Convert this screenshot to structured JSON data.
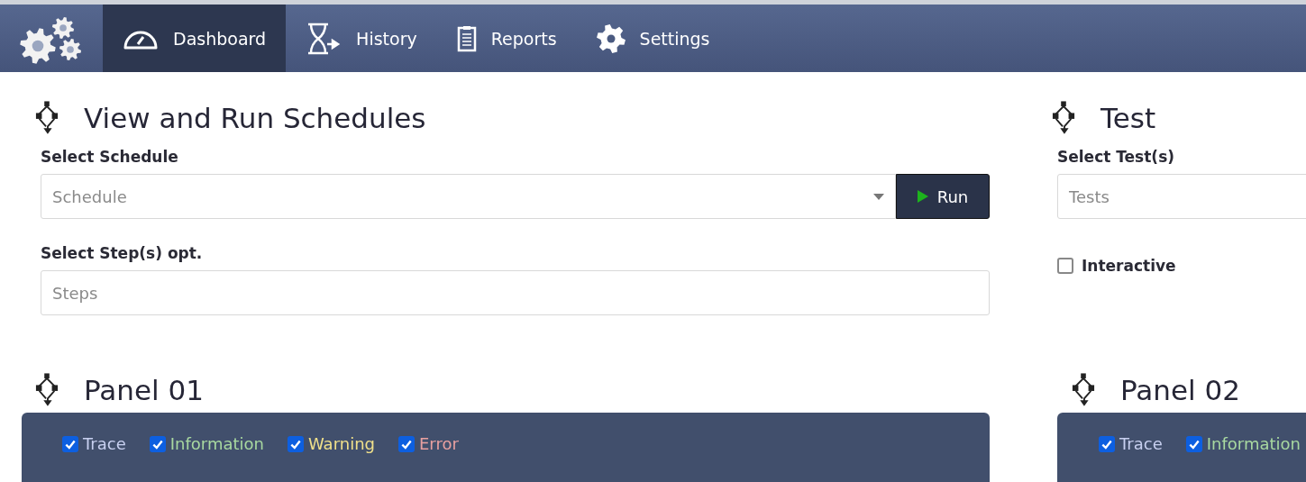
{
  "nav": {
    "items": [
      {
        "label": "Dashboard",
        "selected": true
      },
      {
        "label": "History",
        "selected": false
      },
      {
        "label": "Reports",
        "selected": false
      },
      {
        "label": "Settings",
        "selected": false
      }
    ]
  },
  "schedules": {
    "title": "View and Run Schedules",
    "schedule_label": "Select Schedule",
    "schedule_placeholder": "Schedule",
    "run_button": "Run",
    "steps_label": "Select Step(s) opt.",
    "steps_placeholder": "Steps"
  },
  "test": {
    "title": "Test",
    "tests_label": "Select Test(s)",
    "tests_placeholder": "Tests",
    "interactive": {
      "label": "Interactive",
      "checked": false
    }
  },
  "panels": [
    {
      "title": "Panel 01",
      "filters": [
        {
          "label": "Trace",
          "checked": true,
          "color": "#c8d0f0"
        },
        {
          "label": "Information",
          "checked": true,
          "color": "#a8d8a0"
        },
        {
          "label": "Warning",
          "checked": true,
          "color": "#f0e08a"
        },
        {
          "label": "Error",
          "checked": true,
          "color": "#e8a0a0"
        }
      ]
    },
    {
      "title": "Panel 02",
      "filters": [
        {
          "label": "Trace",
          "checked": true,
          "color": "#c8d0f0"
        },
        {
          "label": "Information",
          "checked": true,
          "color": "#a8d8a0"
        }
      ]
    }
  ]
}
